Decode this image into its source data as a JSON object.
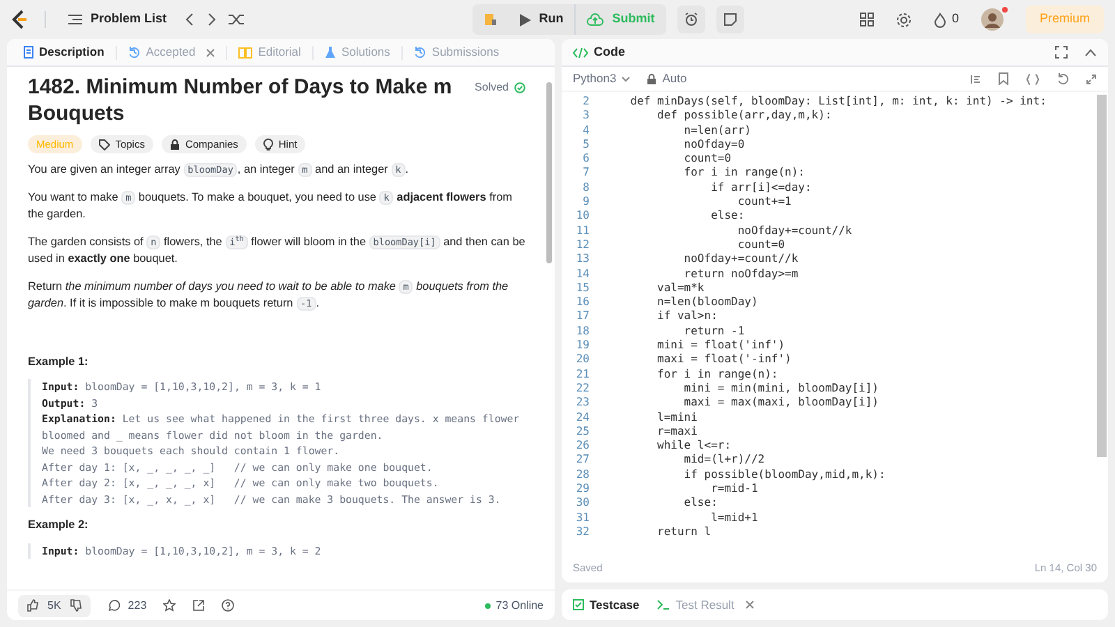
{
  "topbar": {
    "problem_list": "Problem List",
    "run": "Run",
    "submit": "Submit",
    "streak": "0",
    "premium": "Premium"
  },
  "left_tabs": [
    {
      "label": "Description",
      "selected": true,
      "closable": false
    },
    {
      "label": "Accepted",
      "selected": false,
      "closable": true
    },
    {
      "label": "Editorial",
      "selected": false,
      "closable": false
    },
    {
      "label": "Solutions",
      "selected": false,
      "closable": false
    },
    {
      "label": "Submissions",
      "selected": false,
      "closable": false
    }
  ],
  "problem": {
    "title": "1482. Minimum Number of Days to Make m Bouquets",
    "status": "Solved",
    "difficulty": "Medium",
    "tags": [
      "Topics",
      "Companies",
      "Hint"
    ],
    "paragraphs": [
      [
        {
          "kind": "text",
          "text": "You are given an integer array "
        },
        {
          "kind": "code",
          "text": "bloomDay"
        },
        {
          "kind": "text",
          "text": ", an integer "
        },
        {
          "kind": "code",
          "text": "m"
        },
        {
          "kind": "text",
          "text": " and an integer "
        },
        {
          "kind": "code",
          "text": "k"
        },
        {
          "kind": "text",
          "text": "."
        }
      ],
      [
        {
          "kind": "text",
          "text": "You want to make "
        },
        {
          "kind": "code",
          "text": "m"
        },
        {
          "kind": "text",
          "text": " bouquets. To make a bouquet, you need to use "
        },
        {
          "kind": "code",
          "text": "k"
        },
        {
          "kind": "bold",
          "text": " adjacent flowers"
        },
        {
          "kind": "text",
          "text": " from the garden."
        }
      ],
      [
        {
          "kind": "text",
          "text": "The garden consists of "
        },
        {
          "kind": "code",
          "text": "n"
        },
        {
          "kind": "text",
          "text": " flowers, the "
        },
        {
          "kind": "code",
          "text": "i$^{th}$"
        },
        {
          "kind": "text",
          "text": " flower will bloom in the "
        },
        {
          "kind": "code",
          "text": "bloomDay[i]"
        },
        {
          "kind": "text",
          "text": " and then can be used in "
        },
        {
          "kind": "bold",
          "text": "exactly one"
        },
        {
          "kind": "text",
          "text": " bouquet."
        }
      ],
      [
        {
          "kind": "text",
          "text": "Return "
        },
        {
          "kind": "italic",
          "text": "the minimum number of days you need to wait to be able to make "
        },
        {
          "kind": "code",
          "text": "m"
        },
        {
          "kind": "italic",
          "text": " bouquets from the garden"
        },
        {
          "kind": "text",
          "text": ". If it is impossible to make m bouquets return "
        },
        {
          "kind": "code",
          "text": "-1"
        },
        {
          "kind": "text",
          "text": "."
        }
      ]
    ],
    "examples": [
      {
        "heading": "Example 1:",
        "lines": [
          {
            "label": "Input:",
            "text": " bloomDay = [1,10,3,10,2], m = 3, k = 1"
          },
          {
            "label": "Output:",
            "text": " 3"
          },
          {
            "label": "Explanation:",
            "text": " Let us see what happened in the first three days. x means flower bloomed and _ means flower did not bloom in the garden."
          },
          {
            "text": "We need 3 bouquets each should contain 1 flower."
          },
          {
            "text": "After day 1: [x, _, _, _, _]   // we can only make one bouquet."
          },
          {
            "text": "After day 2: [x, _, _, _, x]   // we can only make two bouquets."
          },
          {
            "text": "After day 3: [x, _, x, _, x]   // we can make 3 bouquets. The answer is 3."
          }
        ]
      },
      {
        "heading": "Example 2:",
        "lines": [
          {
            "label": "Input:",
            "text": " bloomDay = [1,10,3,10,2], m = 3, k = 2"
          }
        ]
      }
    ]
  },
  "footer": {
    "likes": "5K",
    "comments": "223",
    "online": "73 Online"
  },
  "code_panel": {
    "title": "Code",
    "language": "Python3",
    "mode": "Auto",
    "saved": "Saved",
    "cursor": "Ln 14, Col 30",
    "lines": [
      {
        "n": "2",
        "text": "    def minDays(self, bloomDay: List[int], m: int, k: int) -> int:"
      },
      {
        "n": "3",
        "text": "        def possible(arr,day,m,k):"
      },
      {
        "n": "4",
        "text": "            n=len(arr)"
      },
      {
        "n": "5",
        "text": "            noOfday=0"
      },
      {
        "n": "6",
        "text": "            count=0"
      },
      {
        "n": "7",
        "text": "            for i in range(n):"
      },
      {
        "n": "8",
        "text": "                if arr[i]<=day:"
      },
      {
        "n": "9",
        "text": "                    count+=1"
      },
      {
        "n": "10",
        "text": "                else:"
      },
      {
        "n": "11",
        "text": "                    noOfday+=count//k"
      },
      {
        "n": "12",
        "text": "                    count=0"
      },
      {
        "n": "13",
        "text": "            noOfday+=count//k"
      },
      {
        "n": "14",
        "text": "            return noOfday>=m"
      },
      {
        "n": "15",
        "text": "        val=m*k"
      },
      {
        "n": "16",
        "text": "        n=len(bloomDay)"
      },
      {
        "n": "17",
        "text": "        if val>n:"
      },
      {
        "n": "18",
        "text": "            return -1"
      },
      {
        "n": "19",
        "text": "        mini = float('inf')"
      },
      {
        "n": "20",
        "text": "        maxi = float('-inf')"
      },
      {
        "n": "21",
        "text": "        for i in range(n):"
      },
      {
        "n": "22",
        "text": "            mini = min(mini, bloomDay[i])"
      },
      {
        "n": "23",
        "text": "            maxi = max(maxi, bloomDay[i])"
      },
      {
        "n": "24",
        "text": "        l=mini"
      },
      {
        "n": "25",
        "text": "        r=maxi"
      },
      {
        "n": "26",
        "text": "        while l<=r:"
      },
      {
        "n": "27",
        "text": "            mid=(l+r)//2"
      },
      {
        "n": "28",
        "text": "            if possible(bloomDay,mid,m,k):"
      },
      {
        "n": "29",
        "text": "                r=mid-1"
      },
      {
        "n": "30",
        "text": "            else:"
      },
      {
        "n": "31",
        "text": "                l=mid+1"
      },
      {
        "n": "32",
        "text": "        return l"
      }
    ]
  },
  "bottom_tabs": [
    {
      "label": "Testcase",
      "selected": true,
      "closable": false
    },
    {
      "label": "Test Result",
      "selected": false,
      "closable": true
    }
  ]
}
